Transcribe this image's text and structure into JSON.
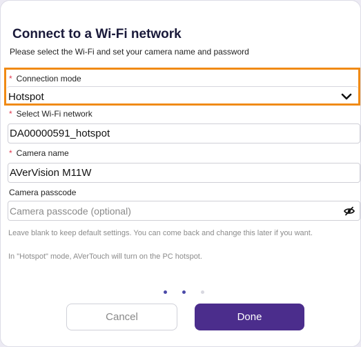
{
  "dialog": {
    "title": "Connect to a Wi-Fi network",
    "subtitle": "Please select the Wi-Fi and set your camera name and password"
  },
  "fields": {
    "connection_mode": {
      "required_mark": "*",
      "label": "Connection mode",
      "value": "Hotspot",
      "icon": "chevron-down-icon"
    },
    "wifi_network": {
      "required_mark": "*",
      "label": "Select Wi-Fi network",
      "value": "DA00000591_hotspot"
    },
    "camera_name": {
      "required_mark": "*",
      "label": "Camera name",
      "value": "AVerVision M11W"
    },
    "camera_passcode": {
      "label": "Camera passcode",
      "value": "",
      "placeholder": "Camera passcode (optional)",
      "icon": "eye-slash-icon"
    }
  },
  "help": {
    "blank_note": "Leave blank to keep default settings. You can come back and change this later if you want.",
    "hotspot_note": "In \"Hotspot\" mode, AVerTouch will turn on the PC hotspot."
  },
  "pager": {
    "total": 3,
    "current": 2
  },
  "buttons": {
    "cancel": "Cancel",
    "done": "Done"
  },
  "colors": {
    "accent": "#4b2d8c",
    "highlight": "#f08a14",
    "required": "#e0384f",
    "dot_active": "#4b4aa8",
    "dot_inactive": "#d8d8e0"
  }
}
